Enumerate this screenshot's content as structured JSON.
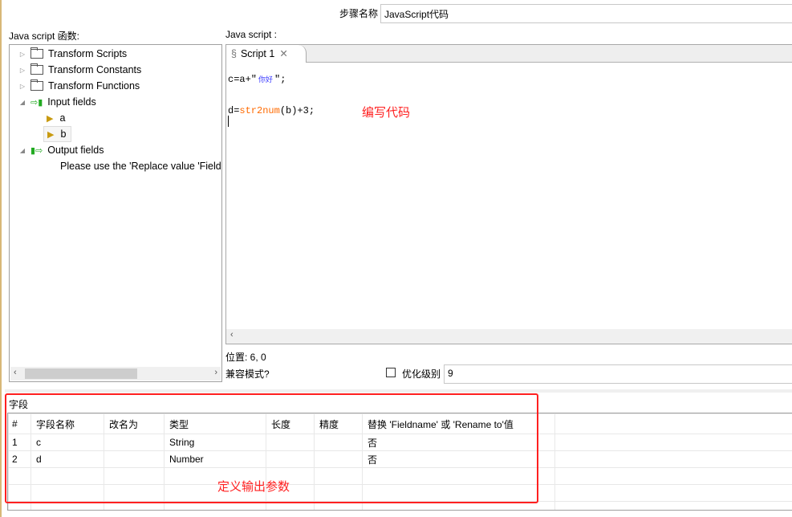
{
  "step_name": {
    "label": "步骤名称",
    "value": "JavaScript代码"
  },
  "functions": {
    "title": "Java script 函数:",
    "tree": [
      {
        "label": "Transform Scripts"
      },
      {
        "label": "Transform Constants"
      },
      {
        "label": "Transform Functions"
      },
      {
        "label": "Input fields",
        "children": [
          "a",
          "b"
        ]
      },
      {
        "label": "Output fields",
        "note": "Please use the 'Replace value 'Field"
      }
    ]
  },
  "script": {
    "title": "Java script :",
    "tab": "Script 1",
    "lines": {
      "l1a": "c=a+\"",
      "l1b": "你好",
      "l1c": "\";",
      "l2a": "d=",
      "l2b": "str2num",
      "l2c": "(b)+3;"
    },
    "annotation": "编写代码"
  },
  "position": "位置: 6, 0",
  "compat_label": "兼容模式?",
  "optimize": {
    "label": "优化级别",
    "value": "9",
    "checked": false
  },
  "fields": {
    "title": "字段",
    "columns": [
      "#",
      "字段名称",
      "改名为",
      "类型",
      "长度",
      "精度",
      "替换 'Fieldname' 或 'Rename to'值"
    ],
    "rows": [
      [
        "1",
        "c",
        "",
        "String",
        "",
        "",
        "否"
      ],
      [
        "2",
        "d",
        "",
        "Number",
        "",
        "",
        "否"
      ]
    ],
    "annotation": "定义输出参数"
  },
  "colors": {
    "accent_red": "#ff2020",
    "func_orange": "#ff6a00",
    "chinese_blue": "#3a3aff"
  }
}
